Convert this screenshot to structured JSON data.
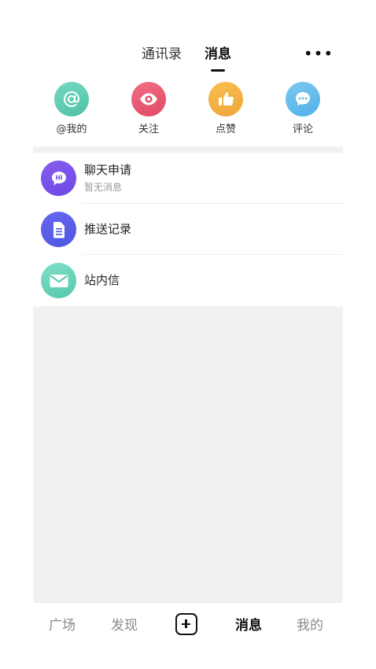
{
  "header": {
    "tabs": [
      {
        "label": "通讯录",
        "active": false
      },
      {
        "label": "消息",
        "active": true
      }
    ],
    "more_label": "•••"
  },
  "quick_actions": [
    {
      "label": "@我的",
      "icon": "at-icon",
      "color": "#5ccbb0"
    },
    {
      "label": "关注",
      "icon": "eye-icon",
      "color": "#e85a72"
    },
    {
      "label": "点赞",
      "icon": "thumbs-up-icon",
      "color": "#f4b244"
    },
    {
      "label": "评论",
      "icon": "comment-icon",
      "color": "#5dbbec"
    }
  ],
  "message_list": [
    {
      "title": "聊天申请",
      "subtitle": "暂无消息",
      "icon": "chat-bubble-icon",
      "color": "#7b52ec"
    },
    {
      "title": "推送记录",
      "icon": "document-icon",
      "color": "#5a5fe8"
    },
    {
      "title": "站内信",
      "icon": "envelope-icon",
      "color": "#69d4bb"
    }
  ],
  "bottom_nav": {
    "items": [
      {
        "label": "广场",
        "active": false
      },
      {
        "label": "发现",
        "active": false
      },
      {
        "label": "消息",
        "active": true
      },
      {
        "label": "我的",
        "active": false
      }
    ],
    "add_icon": "plus-square-icon"
  }
}
